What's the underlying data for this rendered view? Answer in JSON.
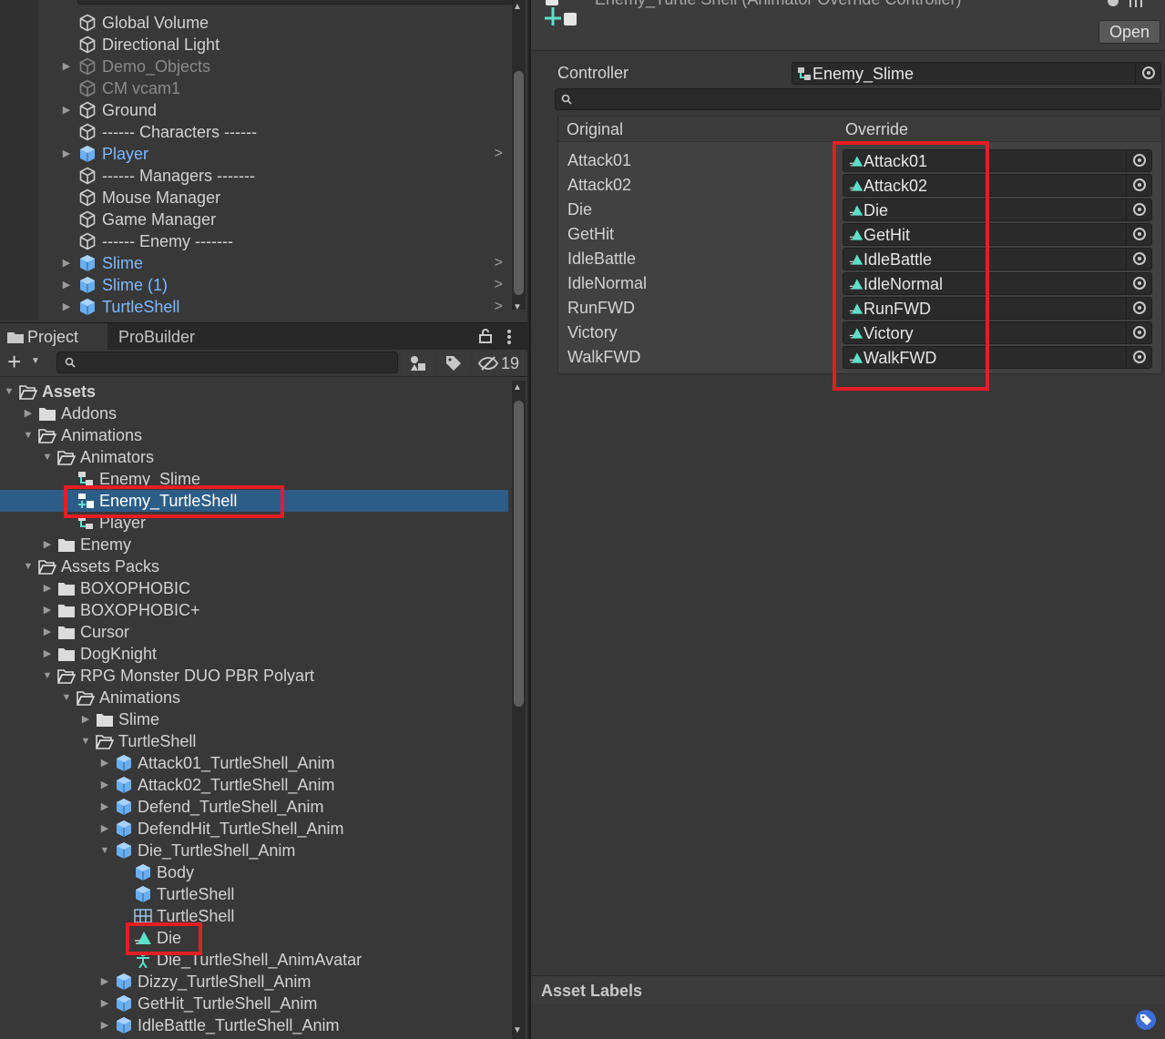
{
  "hierarchy": {
    "items": [
      {
        "label": "Global Volume",
        "style": "normal",
        "arrow": false,
        "chevron": false
      },
      {
        "label": "Directional Light",
        "style": "normal",
        "arrow": false,
        "chevron": false
      },
      {
        "label": "Demo_Objects",
        "style": "dim",
        "arrow": true,
        "chevron": false
      },
      {
        "label": "CM vcam1",
        "style": "dim",
        "arrow": false,
        "chevron": false
      },
      {
        "label": "Ground",
        "style": "normal",
        "arrow": true,
        "chevron": false
      },
      {
        "label": "------ Characters ------",
        "style": "normal",
        "arrow": false,
        "chevron": false
      },
      {
        "label": "Player",
        "style": "prefab",
        "arrow": true,
        "chevron": true
      },
      {
        "label": "------ Managers -------",
        "style": "normal",
        "arrow": false,
        "chevron": false
      },
      {
        "label": "Mouse Manager",
        "style": "normal",
        "arrow": false,
        "chevron": false
      },
      {
        "label": "Game Manager",
        "style": "normal",
        "arrow": false,
        "chevron": false
      },
      {
        "label": "------ Enemy -------",
        "style": "normal",
        "arrow": false,
        "chevron": false
      },
      {
        "label": "Slime",
        "style": "prefab",
        "arrow": true,
        "chevron": true
      },
      {
        "label": "Slime (1)",
        "style": "prefab",
        "arrow": true,
        "chevron": true
      },
      {
        "label": "TurtleShell",
        "style": "prefab",
        "arrow": true,
        "chevron": true
      }
    ]
  },
  "project": {
    "tabs": {
      "project": "Project",
      "probuilder": "ProBuilder"
    },
    "toolbar": {
      "add": "+",
      "hidden_count": "19"
    },
    "search": {
      "placeholder": ""
    },
    "tree": [
      {
        "label": "Assets",
        "depth": 0,
        "arrow": "open",
        "icon": "folder-open-icon",
        "bold": true
      },
      {
        "label": "Addons",
        "depth": 1,
        "arrow": "closed",
        "icon": "folder-icon"
      },
      {
        "label": "Animations",
        "depth": 1,
        "arrow": "open",
        "icon": "folder-open-icon"
      },
      {
        "label": "Animators",
        "depth": 2,
        "arrow": "open",
        "icon": "folder-open-icon"
      },
      {
        "label": "Enemy_Slime",
        "depth": 3,
        "arrow": "none",
        "icon": "animator-controller-icon"
      },
      {
        "label": "Enemy_TurtleShell",
        "depth": 3,
        "arrow": "none",
        "icon": "animator-override-icon",
        "selected": true,
        "highlight": true
      },
      {
        "label": "Player",
        "depth": 3,
        "arrow": "none",
        "icon": "animator-controller-icon"
      },
      {
        "label": "Enemy",
        "depth": 2,
        "arrow": "closed",
        "icon": "folder-icon"
      },
      {
        "label": "Assets Packs",
        "depth": 1,
        "arrow": "open",
        "icon": "folder-open-icon"
      },
      {
        "label": "BOXOPHOBIC",
        "depth": 2,
        "arrow": "closed",
        "icon": "folder-icon"
      },
      {
        "label": "BOXOPHOBIC+",
        "depth": 2,
        "arrow": "closed",
        "icon": "folder-icon"
      },
      {
        "label": "Cursor",
        "depth": 2,
        "arrow": "closed",
        "icon": "folder-icon"
      },
      {
        "label": "DogKnight",
        "depth": 2,
        "arrow": "closed",
        "icon": "folder-icon"
      },
      {
        "label": "RPG Monster DUO PBR Polyart",
        "depth": 2,
        "arrow": "open",
        "icon": "folder-open-icon"
      },
      {
        "label": "Animations",
        "depth": 3,
        "arrow": "open",
        "icon": "folder-open-icon"
      },
      {
        "label": "Slime",
        "depth": 4,
        "arrow": "closed",
        "icon": "folder-icon"
      },
      {
        "label": "TurtleShell",
        "depth": 4,
        "arrow": "open",
        "icon": "folder-open-icon"
      },
      {
        "label": "Attack01_TurtleShell_Anim",
        "depth": 5,
        "arrow": "closed",
        "icon": "model-prefab-icon"
      },
      {
        "label": "Attack02_TurtleShell_Anim",
        "depth": 5,
        "arrow": "closed",
        "icon": "model-prefab-icon"
      },
      {
        "label": "Defend_TurtleShell_Anim",
        "depth": 5,
        "arrow": "closed",
        "icon": "model-prefab-icon"
      },
      {
        "label": "DefendHit_TurtleShell_Anim",
        "depth": 5,
        "arrow": "closed",
        "icon": "model-prefab-icon"
      },
      {
        "label": "Die_TurtleShell_Anim",
        "depth": 5,
        "arrow": "open",
        "icon": "model-prefab-icon"
      },
      {
        "label": "Body",
        "depth": 6,
        "arrow": "none",
        "icon": "mesh-prefab-icon"
      },
      {
        "label": "TurtleShell",
        "depth": 6,
        "arrow": "none",
        "icon": "mesh-prefab-icon"
      },
      {
        "label": "TurtleShell",
        "depth": 6,
        "arrow": "none",
        "icon": "mesh-grid-icon"
      },
      {
        "label": "Die",
        "depth": 6,
        "arrow": "none",
        "icon": "animation-clip-icon",
        "highlight": true
      },
      {
        "label": "Die_TurtleShell_AnimAvatar",
        "depth": 6,
        "arrow": "none",
        "icon": "avatar-icon"
      },
      {
        "label": "Dizzy_TurtleShell_Anim",
        "depth": 5,
        "arrow": "closed",
        "icon": "model-prefab-icon"
      },
      {
        "label": "GetHit_TurtleShell_Anim",
        "depth": 5,
        "arrow": "closed",
        "icon": "model-prefab-icon"
      },
      {
        "label": "IdleBattle_TurtleShell_Anim",
        "depth": 5,
        "arrow": "closed",
        "icon": "model-prefab-icon"
      }
    ]
  },
  "inspector": {
    "title": "Enemy_Turtle Shell (Animator Override Controller)",
    "open_button": "Open",
    "controller_label": "Controller",
    "controller_value": "Enemy_Slime",
    "table_headers": {
      "original": "Original",
      "override": "Override"
    },
    "overrides": [
      {
        "original": "Attack01",
        "override": "Attack01"
      },
      {
        "original": "Attack02",
        "override": "Attack02"
      },
      {
        "original": "Die",
        "override": "Die"
      },
      {
        "original": "GetHit",
        "override": "GetHit"
      },
      {
        "original": "IdleBattle",
        "override": "IdleBattle"
      },
      {
        "original": "IdleNormal",
        "override": "IdleNormal"
      },
      {
        "original": "RunFWD",
        "override": "RunFWD"
      },
      {
        "original": "Victory",
        "override": "Victory"
      },
      {
        "original": "WalkFWD",
        "override": "WalkFWD"
      }
    ],
    "asset_labels": "Asset Labels"
  },
  "colors": {
    "highlight": "#e31e24",
    "selection": "#2c5d87",
    "prefab_text": "#7fb8ff",
    "clip_icon": "#5ee0c8"
  }
}
